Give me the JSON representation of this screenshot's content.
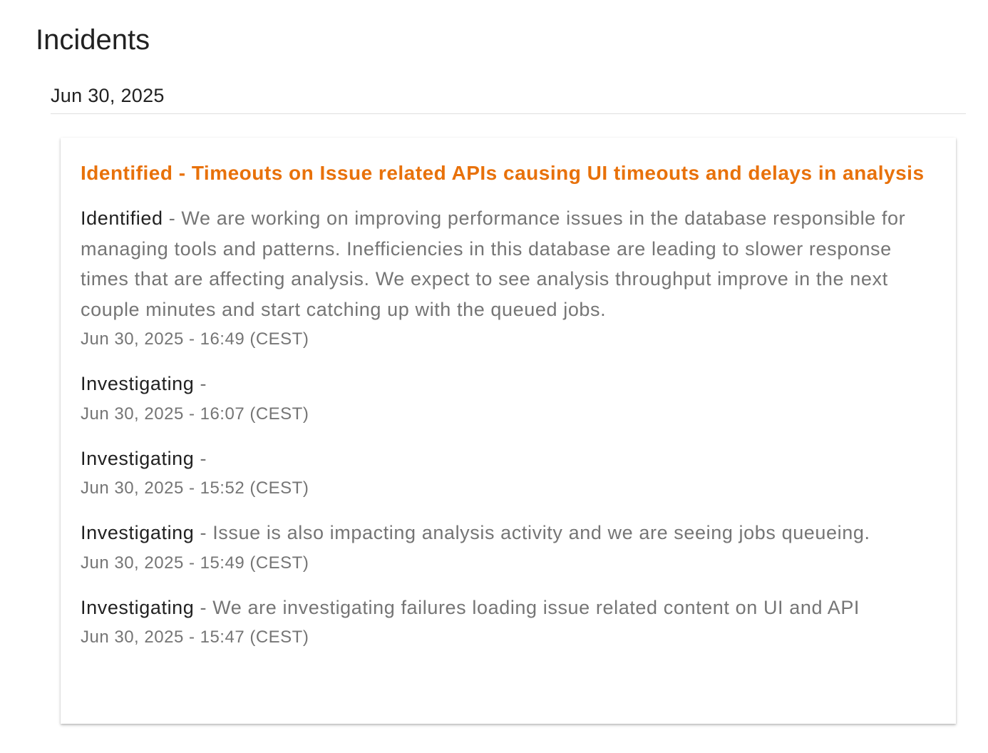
{
  "page": {
    "title": "Incidents"
  },
  "date_group": {
    "date": "Jun 30, 2025"
  },
  "incident": {
    "title": "Identified - Timeouts on Issue related APIs causing UI timeouts and delays in analysis",
    "title_color": "#e8710a",
    "separator": " - ",
    "updates": [
      {
        "status": "Identified",
        "message": "We are working on improving performance issues in the database responsible for managing tools and patterns. Inefficiencies in this database are leading to slower response times that are affecting analysis. We expect to see analysis throughput improve in the next couple minutes and start catching up with the queued jobs.",
        "timestamp": "Jun 30, 2025 - 16:49 (CEST)"
      },
      {
        "status": "Investigating",
        "message": "",
        "timestamp": "Jun 30, 2025 - 16:07 (CEST)"
      },
      {
        "status": "Investigating",
        "message": "",
        "timestamp": "Jun 30, 2025 - 15:52 (CEST)"
      },
      {
        "status": "Investigating",
        "message": "Issue is also impacting analysis activity and we are seeing jobs queueing.",
        "timestamp": "Jun 30, 2025 - 15:49 (CEST)"
      },
      {
        "status": "Investigating",
        "message": "We are investigating failures loading issue related content on UI and API",
        "timestamp": "Jun 30, 2025 - 15:47 (CEST)"
      }
    ]
  }
}
